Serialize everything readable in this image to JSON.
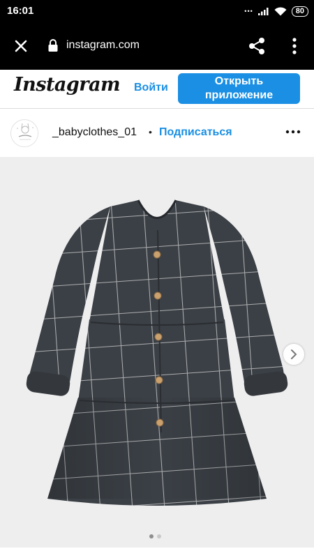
{
  "status_bar": {
    "time": "16:01",
    "battery": "80",
    "icons": [
      "dots-icon",
      "signal-icon",
      "wifi-icon",
      "battery-icon"
    ]
  },
  "browser": {
    "url": "instagram.com",
    "icons": [
      "close-icon",
      "lock-icon",
      "share-icon",
      "more-vertical-icon"
    ]
  },
  "header": {
    "logo": "Instagram",
    "login_label": "Войти",
    "open_app_line1": "Открыть",
    "open_app_line2": "приложение",
    "accent_color": "#1a8fe3"
  },
  "post": {
    "username": "_babyclothes_01",
    "separator": "•",
    "follow_label": "Подписаться",
    "icons": [
      "avatar-logo",
      "more-horizontal-icon",
      "chevron-right-icon"
    ],
    "carousel": {
      "total": 2,
      "active": 1
    }
  }
}
